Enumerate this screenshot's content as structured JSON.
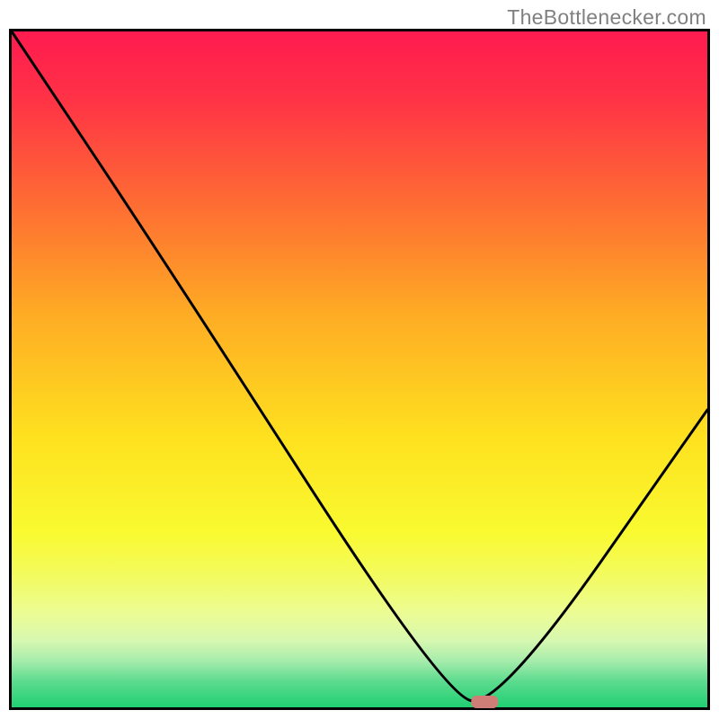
{
  "watermark": "TheBottlenecker.com",
  "chart_data": {
    "type": "line",
    "title": "",
    "xlabel": "",
    "ylabel": "",
    "xlim": [
      0,
      100
    ],
    "ylim": [
      0,
      100
    ],
    "grid": false,
    "curve_points_pct": [
      [
        0,
        100
      ],
      [
        22,
        66
      ],
      [
        62,
        2
      ],
      [
        70,
        0
      ],
      [
        100,
        44
      ]
    ],
    "marker": {
      "x_pct": 68,
      "y_pct": 0.8,
      "color": "#cf7d77"
    },
    "gradient_stops": [
      {
        "pct": 0,
        "color": "#ff1a4f"
      },
      {
        "pct": 10,
        "color": "#ff3246"
      },
      {
        "pct": 25,
        "color": "#fe6a34"
      },
      {
        "pct": 42,
        "color": "#feac24"
      },
      {
        "pct": 60,
        "color": "#fee11f"
      },
      {
        "pct": 74,
        "color": "#f9fa30"
      },
      {
        "pct": 80,
        "color": "#f3fb5b"
      },
      {
        "pct": 86,
        "color": "#ecfc94"
      },
      {
        "pct": 90,
        "color": "#d7f8b0"
      },
      {
        "pct": 93,
        "color": "#a7ecac"
      },
      {
        "pct": 96,
        "color": "#5ddb8f"
      },
      {
        "pct": 100,
        "color": "#1ecf72"
      }
    ]
  }
}
